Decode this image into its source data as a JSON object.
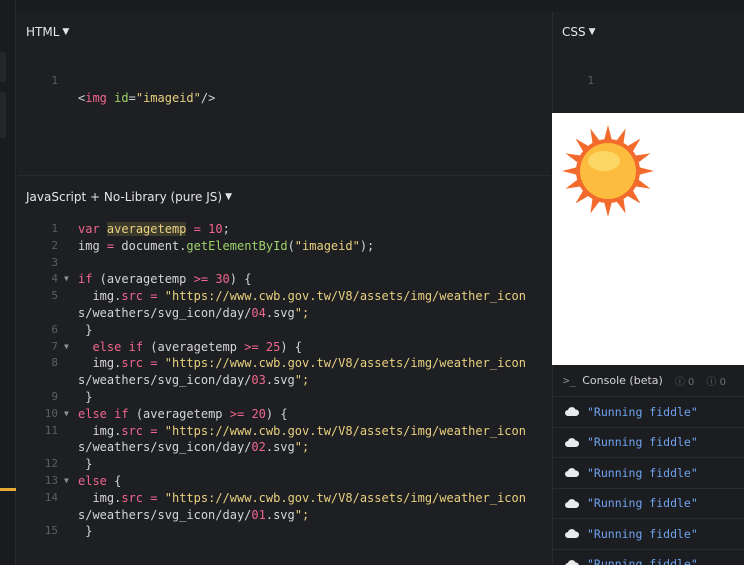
{
  "panels": {
    "html": {
      "title": "HTML",
      "lines": [
        {
          "n": "1",
          "text": "<img id=\"imageid\"/>"
        }
      ]
    },
    "css": {
      "title": "CSS",
      "lines": [
        {
          "n": "1"
        }
      ]
    },
    "js": {
      "title": "JavaScript + No-Library (pure JS)",
      "line_numbers": [
        "1",
        "2",
        "3",
        "4",
        "5",
        "",
        "6",
        "7",
        "8",
        "",
        "9",
        "10",
        "11",
        "",
        "12",
        "13",
        "14",
        "",
        "15"
      ],
      "code": [
        "var averagetemp = 10;",
        "img = document.getElementById(\"imageid\");",
        "",
        "if (averagetemp >= 30) {",
        "  img.src = \"https://www.cwb.gov.tw/V8/assets/img/weather_icon",
        "s/weathers/svg_icon/day/04.svg\";",
        " }",
        "  else if (averagetemp >= 25) {",
        "  img.src = \"https://www.cwb.gov.tw/V8/assets/img/weather_icon",
        "s/weathers/svg_icon/day/03.svg\";",
        " }",
        "else if (averagetemp >= 20) {",
        "  img.src = \"https://www.cwb.gov.tw/V8/assets/img/weather_icon",
        "s/weathers/svg_icon/day/02.svg\";",
        " }",
        "else {",
        "  img.src = \"https://www.cwb.gov.tw/V8/assets/img/weather_icon",
        "s/weathers/svg_icon/day/01.svg\";",
        " }"
      ]
    }
  },
  "console": {
    "title": "Console (beta)",
    "prompt": ">_",
    "info_count": "0",
    "warn_count": "0",
    "messages": [
      "\"Running fiddle\"",
      "\"Running fiddle\"",
      "\"Running fiddle\"",
      "\"Running fiddle\"",
      "\"Running fiddle\"",
      "\"Running fiddle\""
    ]
  },
  "result": {
    "image_icon": "sun-icon",
    "sun_colors": {
      "rays": "#f26b2c",
      "core": "#fcbc3d",
      "core_light": "#fdd766"
    }
  }
}
